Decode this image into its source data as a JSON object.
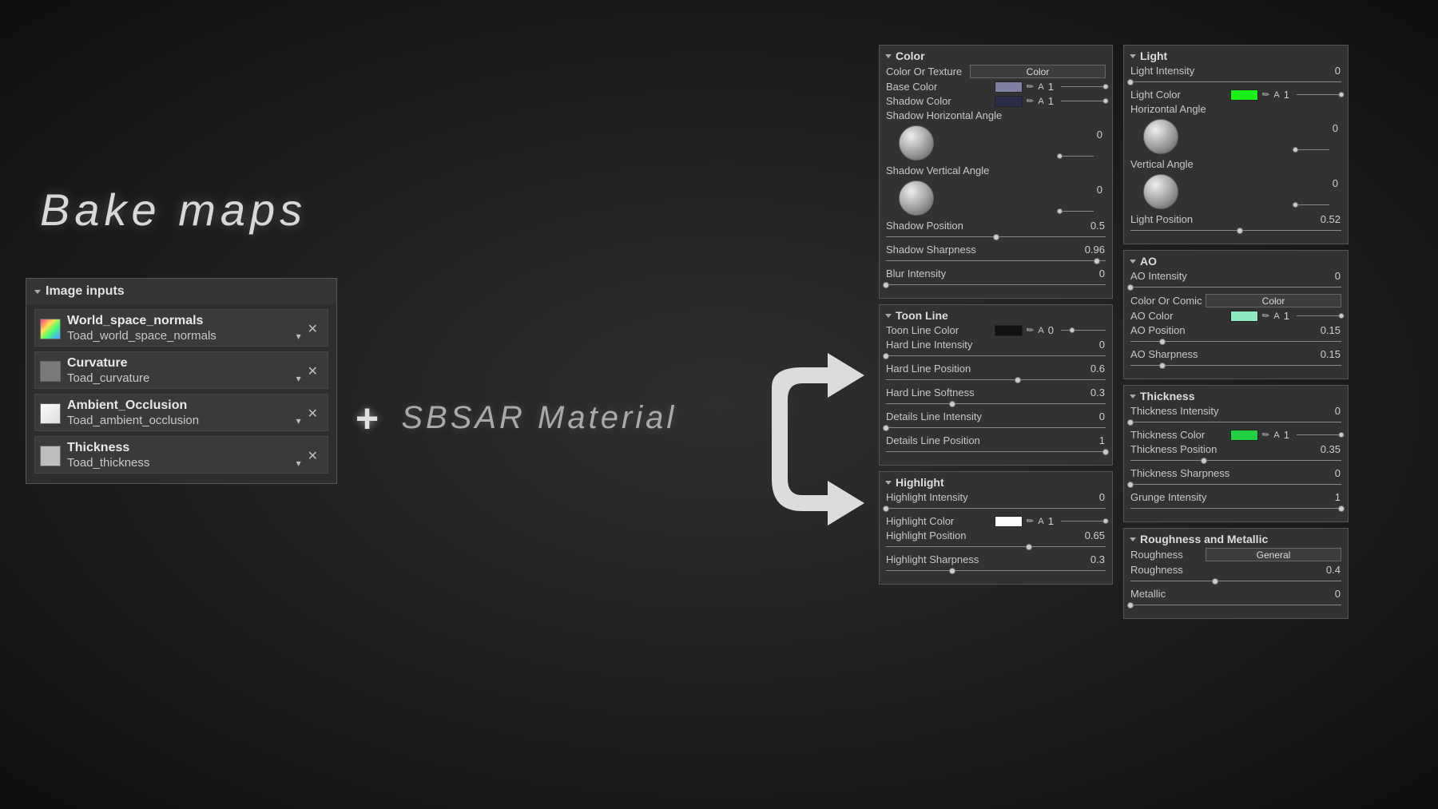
{
  "title": "Bake maps",
  "plus_line": "SBSAR Material",
  "image_inputs": {
    "header": "Image inputs",
    "items": [
      {
        "name": "World_space_normals",
        "source": "Toad_world_space_normals",
        "thumb": "th-normals"
      },
      {
        "name": "Curvature",
        "source": "Toad_curvature",
        "thumb": "th-curv"
      },
      {
        "name": "Ambient_Occlusion",
        "source": "Toad_ambient_occlusion",
        "thumb": "th-ao"
      },
      {
        "name": "Thickness",
        "source": "Toad_thickness",
        "thumb": "th-thick"
      }
    ]
  },
  "panels_a": [
    {
      "name": "Color",
      "rows": [
        {
          "type": "btn",
          "label": "Color Or Texture",
          "btn": "Color"
        },
        {
          "type": "color",
          "label": "Base Color",
          "swatch": "#7F7FA6",
          "alpha": "1"
        },
        {
          "type": "color",
          "label": "Shadow Color",
          "swatch": "#2A2A49",
          "alpha": "1"
        },
        {
          "type": "dial",
          "label": "Shadow Horizontal Angle",
          "value": "0"
        },
        {
          "type": "dial",
          "label": "Shadow Vertical Angle",
          "value": "0"
        },
        {
          "type": "slider",
          "label": "Shadow Position",
          "value": "0.5",
          "pos": 50
        },
        {
          "type": "slider",
          "label": "Shadow Sharpness",
          "value": "0.96",
          "pos": 96
        },
        {
          "type": "slider",
          "label": "Blur Intensity",
          "value": "0",
          "pos": 0
        }
      ]
    },
    {
      "name": "Toon Line",
      "rows": [
        {
          "type": "color2",
          "label": "Toon Line Color",
          "swatch": "#111111",
          "value": "0",
          "pos": 25
        },
        {
          "type": "slider",
          "label": "Hard Line Intensity",
          "value": "0",
          "pos": 0
        },
        {
          "type": "slider",
          "label": "Hard Line Position",
          "value": "0.6",
          "pos": 60
        },
        {
          "type": "slider",
          "label": "Hard Line Softness",
          "value": "0.3",
          "pos": 30
        },
        {
          "type": "slider",
          "label": "Details Line Intensity",
          "value": "0",
          "pos": 0
        },
        {
          "type": "slider",
          "label": "Details Line Position",
          "value": "1",
          "pos": 100
        }
      ]
    },
    {
      "name": "Highlight",
      "rows": [
        {
          "type": "slider",
          "label": "Highlight Intensity",
          "value": "0",
          "pos": 0
        },
        {
          "type": "color",
          "label": "Highlight Color",
          "swatch": "#FFFFFF",
          "alpha": "1"
        },
        {
          "type": "slider",
          "label": "Highlight Position",
          "value": "0.65",
          "pos": 65
        },
        {
          "type": "slider",
          "label": "Highlight Sharpness",
          "value": "0.3",
          "pos": 30
        }
      ]
    }
  ],
  "panels_b": [
    {
      "name": "Light",
      "rows": [
        {
          "type": "slider",
          "label": "Light Intensity",
          "value": "0",
          "pos": 0
        },
        {
          "type": "color",
          "label": "Light Color",
          "swatch": "#18F018",
          "alpha": "1"
        },
        {
          "type": "dial",
          "label": "Horizontal Angle",
          "value": "0"
        },
        {
          "type": "dial",
          "label": "Vertical Angle",
          "value": "0"
        },
        {
          "type": "slider",
          "label": "Light Position",
          "value": "0.52",
          "pos": 52
        }
      ]
    },
    {
      "name": "AO",
      "rows": [
        {
          "type": "slider",
          "label": "AO Intensity",
          "value": "0",
          "pos": 0
        },
        {
          "type": "btn",
          "label": "Color Or Comic",
          "btn": "Color"
        },
        {
          "type": "color",
          "label": "AO Color",
          "swatch": "#8EE8C0",
          "alpha": "1"
        },
        {
          "type": "slider",
          "label": "AO Position",
          "value": "0.15",
          "pos": 15
        },
        {
          "type": "slider",
          "label": "AO Sharpness",
          "value": "0.15",
          "pos": 15
        }
      ]
    },
    {
      "name": "Thickness",
      "rows": [
        {
          "type": "slider",
          "label": "Thickness Intensity",
          "value": "0",
          "pos": 0
        },
        {
          "type": "color",
          "label": "Thickness Color",
          "swatch": "#20D040",
          "alpha": "1"
        },
        {
          "type": "slider",
          "label": "Thickness Position",
          "value": "0.35",
          "pos": 35
        },
        {
          "type": "slider",
          "label": "Thickness Sharpness",
          "value": "0",
          "pos": 0
        },
        {
          "type": "slider",
          "label": "Grunge Intensity",
          "value": "1",
          "pos": 100
        }
      ]
    },
    {
      "name": "Roughness and Metallic",
      "rows": [
        {
          "type": "btn",
          "label": "Roughness",
          "btn": "General"
        },
        {
          "type": "slider",
          "label": "Roughness",
          "value": "0.4",
          "pos": 40
        },
        {
          "type": "slider",
          "label": "Metallic",
          "value": "0",
          "pos": 0
        }
      ]
    }
  ]
}
